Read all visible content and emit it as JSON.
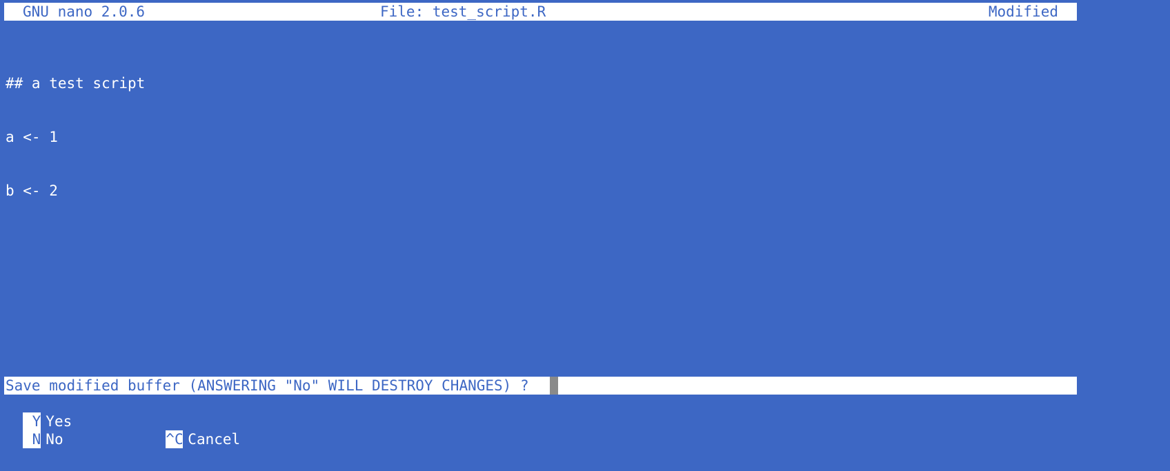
{
  "colors": {
    "background": "#3d67c4",
    "bar_background": "#ffffff",
    "bar_text": "#3d67c4",
    "cursor": "#8a8a8a"
  },
  "titlebar": {
    "app": "GNU nano 2.0.6",
    "file": "File: test_script.R",
    "status": "Modified"
  },
  "editor": {
    "lines": [
      "## a test script",
      "a <- 1",
      "b <- 2"
    ]
  },
  "prompt": {
    "text": "Save modified buffer (ANSWERING \"No\" WILL DESTROY CHANGES) ?"
  },
  "options": [
    {
      "key": "Y",
      "label": "Yes"
    },
    {
      "key": "N",
      "label": "No"
    },
    {
      "key": "^C",
      "label": "Cancel"
    }
  ]
}
